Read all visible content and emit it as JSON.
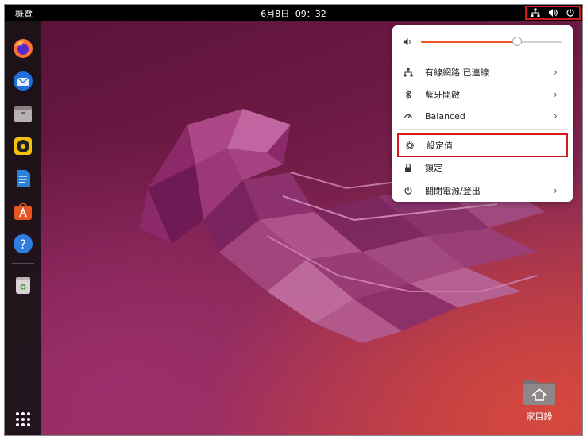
{
  "topbar": {
    "activities_label": "概覽",
    "date": "6月8日",
    "time": "09：32",
    "tray_icons": [
      "network-wired-icon",
      "speaker-icon",
      "power-icon"
    ]
  },
  "dock": {
    "items": [
      "firefox-icon",
      "thunderbird-icon",
      "files-icon",
      "rhythmbox-icon",
      "libreoffice-writer-icon",
      "software-center-icon",
      "help-icon",
      "trash-icon"
    ],
    "app_grid": "app-grid-icon"
  },
  "desktop": {
    "home_folder_label": "家目錄"
  },
  "quick_settings": {
    "volume_level": 0.68,
    "items": [
      {
        "label": "有線網路 已連線",
        "icon": "network-wired-icon",
        "has_arrow": true
      },
      {
        "label": "藍牙開啟",
        "icon": "bluetooth-icon",
        "has_arrow": true
      },
      {
        "label": "Balanced",
        "icon": "power-profile-icon",
        "has_arrow": true
      },
      {
        "label": "設定值",
        "icon": "settings-gear-icon",
        "has_arrow": false
      },
      {
        "label": "鎖定",
        "icon": "lock-icon",
        "has_arrow": false
      },
      {
        "label": "關閉電源/登出",
        "icon": "power-icon",
        "has_arrow": true
      }
    ]
  },
  "colors": {
    "accent": "#e95420",
    "highlight_box": "#d7191c"
  }
}
